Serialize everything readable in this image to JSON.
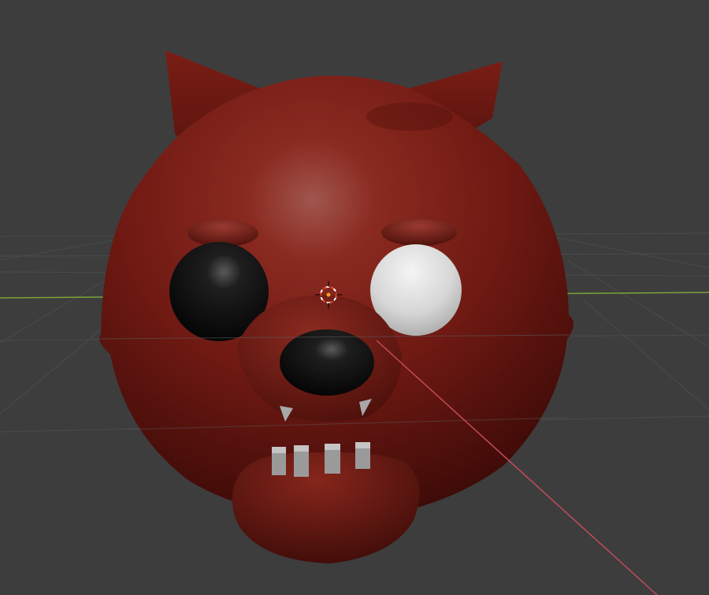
{
  "viewport": {
    "background": "#3d3d3d",
    "grid_color": "#4a4a4a",
    "x_axis_color": "#c54a5a",
    "y_axis_color": "#7aa33a"
  },
  "model": {
    "name": "red-cat-head",
    "skin_color": "#7a1e16",
    "skin_dark": "#3e0c08",
    "eye_left_color": "#0b0b0b",
    "eye_right_color": "#d8d8d8",
    "nose_color": "#0b0b0b",
    "teeth_color": "#9a9a9a",
    "teeth_count": 4
  },
  "cursor_3d": {
    "icon": "3d-cursor-icon",
    "ring_color_a": "#e84a2e",
    "ring_color_b": "#ffffff"
  }
}
